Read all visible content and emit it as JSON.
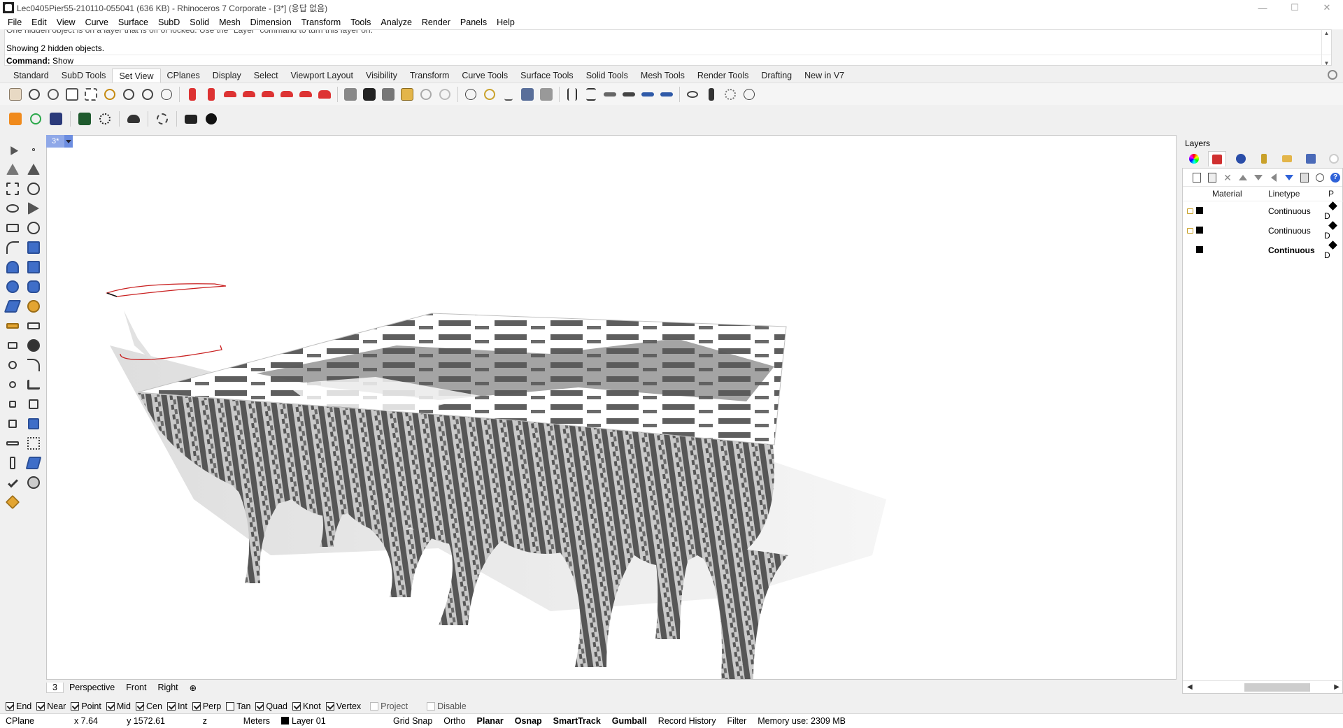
{
  "window": {
    "title": "Lec0405Pier55-210110-055041 (636 KB) - Rhinoceros 7 Corporate - [3*] (응답 없음)",
    "minimize": "—",
    "maximize": "☐",
    "close": "✕"
  },
  "menu": [
    "File",
    "Edit",
    "View",
    "Curve",
    "Surface",
    "SubD",
    "Solid",
    "Mesh",
    "Dimension",
    "Transform",
    "Tools",
    "Analyze",
    "Render",
    "Panels",
    "Help"
  ],
  "command": {
    "history_cut": "One hidden object is on a layer that is off or locked. Use the \"Layer\" command to turn this layer on.",
    "history_last": "Showing 2 hidden objects.",
    "prompt_label": "Command:",
    "prompt_value": "Show"
  },
  "toolbar_tabs": [
    "Standard",
    "SubD Tools",
    "Set View",
    "CPlanes",
    "Display",
    "Select",
    "Viewport Layout",
    "Visibility",
    "Transform",
    "Curve Tools",
    "Surface Tools",
    "Solid Tools",
    "Mesh Tools",
    "Render Tools",
    "Drafting",
    "New in V7"
  ],
  "active_tab": "Set View",
  "viewport": {
    "title": "3*",
    "tabs": [
      "3",
      "Perspective",
      "Front",
      "Right"
    ],
    "add_tab": "⊕"
  },
  "layers": {
    "panel_title": "Layers",
    "columns": [
      "Material",
      "Linetype",
      "P"
    ],
    "rows": [
      {
        "linetype": "Continuous",
        "print": "D",
        "bold": false,
        "locked": true
      },
      {
        "linetype": "Continuous",
        "print": "D",
        "bold": false,
        "locked": true
      },
      {
        "linetype": "Continuous",
        "print": "D",
        "bold": true,
        "locked": false
      }
    ]
  },
  "osnap": [
    {
      "label": "End",
      "checked": true
    },
    {
      "label": "Near",
      "checked": true
    },
    {
      "label": "Point",
      "checked": true
    },
    {
      "label": "Mid",
      "checked": true
    },
    {
      "label": "Cen",
      "checked": true
    },
    {
      "label": "Int",
      "checked": true
    },
    {
      "label": "Perp",
      "checked": true
    },
    {
      "label": "Tan",
      "checked": false
    },
    {
      "label": "Quad",
      "checked": true
    },
    {
      "label": "Knot",
      "checked": true
    },
    {
      "label": "Vertex",
      "checked": true
    },
    {
      "label": "Project",
      "checked": false,
      "disabled": true
    },
    {
      "label": "Disable",
      "checked": false,
      "disabled": true
    }
  ],
  "status": {
    "cplane": "CPlane",
    "x": "x 7.64",
    "y": "y 1572.61",
    "z": "z",
    "units": "Meters",
    "layer": "Layer 01",
    "grid_snap": "Grid Snap",
    "ortho": "Ortho",
    "planar": "Planar",
    "osnap": "Osnap",
    "smarttrack": "SmartTrack",
    "gumball": "Gumball",
    "record_history": "Record History",
    "filter": "Filter",
    "memory": "Memory use: 2309 MB"
  }
}
